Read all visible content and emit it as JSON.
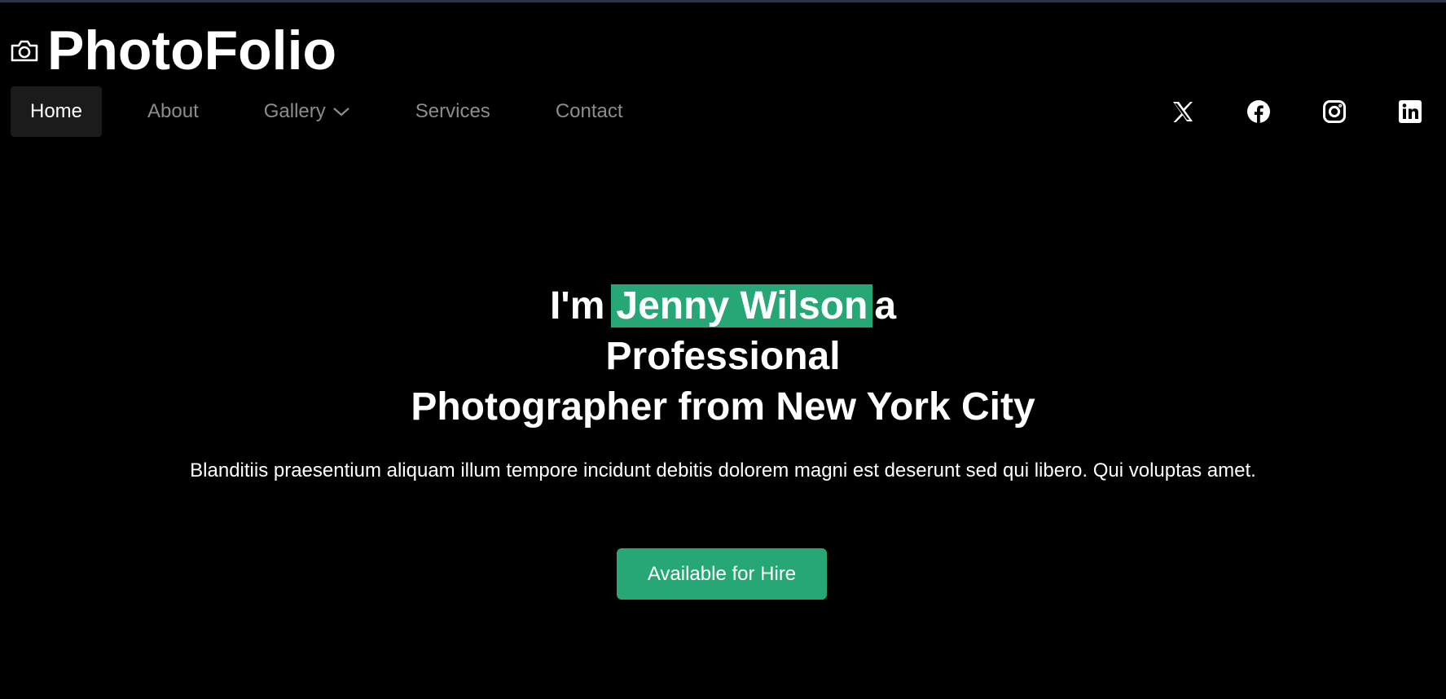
{
  "brand": {
    "name": "PhotoFolio",
    "icon": "camera-icon"
  },
  "nav": {
    "items": [
      {
        "label": "Home",
        "active": true
      },
      {
        "label": "About",
        "active": false
      },
      {
        "label": "Gallery",
        "active": false,
        "has_dropdown": true
      },
      {
        "label": "Services",
        "active": false
      },
      {
        "label": "Contact",
        "active": false
      }
    ]
  },
  "social": [
    "x-icon",
    "facebook-icon",
    "instagram-icon",
    "linkedin-icon"
  ],
  "hero": {
    "intro": "I'm",
    "name": "Jenny Wilson",
    "after_name": "a",
    "line2": "Professional",
    "line3": "Photographer from New York City",
    "description": "Blanditiis praesentium aliquam illum tempore incidunt debitis dolorem magni est deserunt sed qui libero. Qui voluptas amet.",
    "cta_label": "Available for Hire"
  },
  "colors": {
    "accent": "#27a776",
    "background": "#000000",
    "nav_inactive": "#8c8c8c"
  }
}
